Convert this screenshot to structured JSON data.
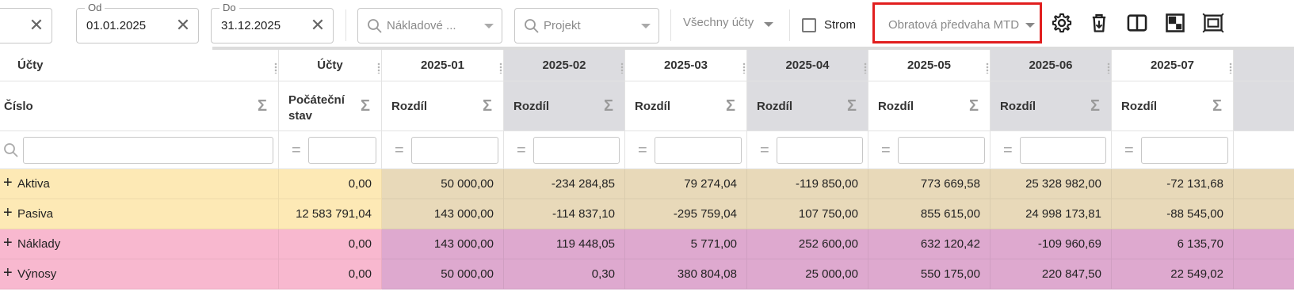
{
  "toolbar": {
    "from": {
      "label": "Od",
      "value": "01.01.2025"
    },
    "to": {
      "label": "Do",
      "value": "31.12.2025"
    },
    "cost_center": {
      "placeholder": "Nákladové ..."
    },
    "project": {
      "placeholder": "Projekt"
    },
    "accounts_filter": "Všechny účty",
    "tree_label": "Strom",
    "report_type": "Obratová předvaha MTD",
    "icons": [
      "gear-icon",
      "delete-columns-icon",
      "split-view-icon",
      "layout-icon",
      "fit-columns-icon"
    ]
  },
  "grid": {
    "group_headers": [
      "Účty",
      "Účty",
      "2025-01",
      "2025-02",
      "2025-03",
      "2025-04",
      "2025-05",
      "2025-06",
      "2025-07"
    ],
    "column_headers": [
      "Číslo",
      "Počáteční stav",
      "Rozdíl",
      "Rozdíl",
      "Rozdíl",
      "Rozdíl",
      "Rozdíl",
      "Rozdíl",
      "Rozdíl"
    ],
    "rows": [
      {
        "label": "Aktiva",
        "opening": "0,00",
        "values": [
          "50 000,00",
          "-234 284,85",
          "79 274,04",
          "-119 850,00",
          "773 669,58",
          "25 328 982,00",
          "-72 131,68"
        ]
      },
      {
        "label": "Pasiva",
        "opening": "12 583 791,04",
        "values": [
          "143 000,00",
          "-114 837,10",
          "-295 759,04",
          "107 750,00",
          "855 615,00",
          "24 998 173,81",
          "-88 545,00"
        ]
      },
      {
        "label": "Náklady",
        "opening": "0,00",
        "values": [
          "143 000,00",
          "119 448,05",
          "5 771,00",
          "252 600,00",
          "632 120,42",
          "-109 960,69",
          "6 135,70"
        ]
      },
      {
        "label": "Výnosy",
        "opening": "0,00",
        "values": [
          "50 000,00",
          "0,30",
          "380 804,08",
          "25 000,00",
          "550 175,00",
          "220 847,50",
          "22 549,02"
        ]
      }
    ]
  },
  "colors": {
    "highlight_border": "#e11e1e",
    "aktiva_pasiva_first": "#fde9b5",
    "aktiva_pasiva_rest": "#e8d9b9",
    "naklady_vynosy_first": "#f8b8cf",
    "naklady_vynosy_rest": "#dea9cf",
    "shaded_column": "#dcdce0"
  }
}
